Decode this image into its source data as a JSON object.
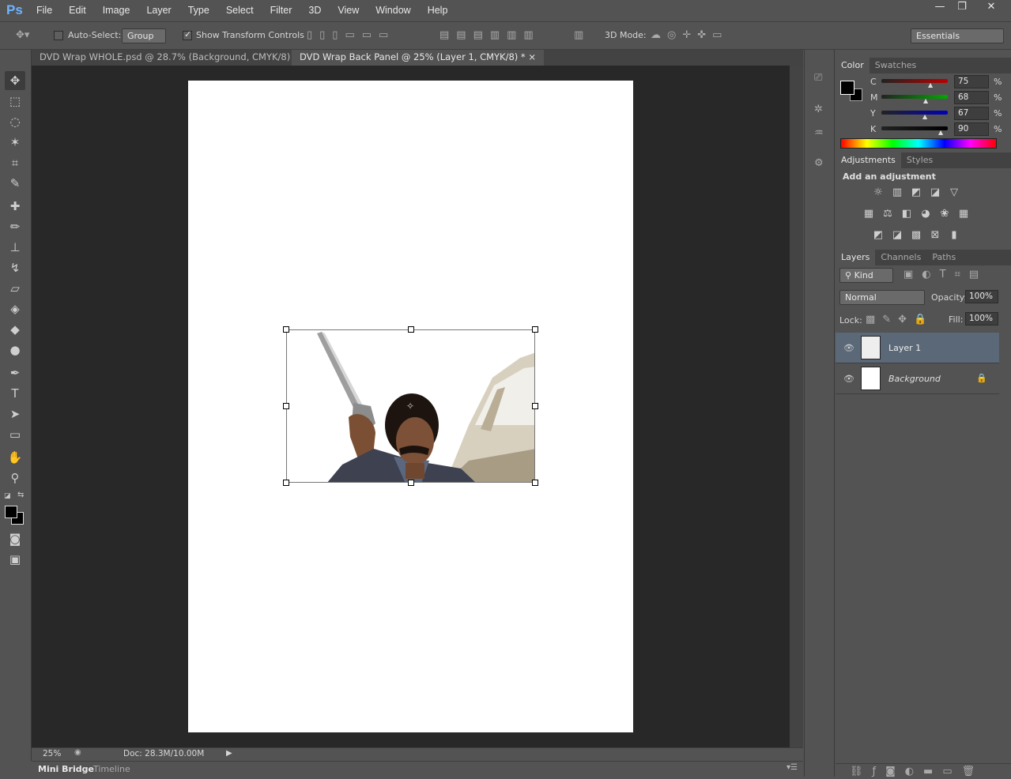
{
  "app": {
    "logo": "Ps"
  },
  "menu": [
    "File",
    "Edit",
    "Image",
    "Layer",
    "Type",
    "Select",
    "Filter",
    "3D",
    "View",
    "Window",
    "Help"
  ],
  "window_controls": {
    "minimize": "—",
    "restore": "❐",
    "close": "✕"
  },
  "options": {
    "auto_select_label": "Auto-Select:",
    "auto_select_value": "Group",
    "show_transform_label": "Show Transform Controls",
    "mode_3d_label": "3D Mode:",
    "workspace": "Essentials"
  },
  "tabs": [
    {
      "label": "DVD Wrap WHOLE.psd @ 28.7% (Background, CMYK/8) *",
      "close": "×"
    },
    {
      "label": "DVD Wrap Back Panel @ 25% (Layer 1, CMYK/8) *",
      "close": "×"
    }
  ],
  "status": {
    "zoom": "25%",
    "doc": "Doc: 28.3M/10.00M"
  },
  "bottom_tabs": [
    "Mini Bridge",
    "Timeline"
  ],
  "color_panel": {
    "tabs": [
      "Color",
      "Swatches"
    ],
    "channels": [
      {
        "name": "C",
        "value": "75",
        "unit": "%",
        "pos": 0.75,
        "color": "#b00"
      },
      {
        "name": "M",
        "value": "68",
        "unit": "%",
        "pos": 0.68,
        "color": "#0a0"
      },
      {
        "name": "Y",
        "value": "67",
        "unit": "%",
        "pos": 0.67,
        "color": "#00b"
      },
      {
        "name": "K",
        "value": "90",
        "unit": "%",
        "pos": 0.9,
        "color": "#000"
      }
    ]
  },
  "adjust_panel": {
    "tabs": [
      "Adjustments",
      "Styles"
    ],
    "heading": "Add an adjustment"
  },
  "layers_panel": {
    "tabs": [
      "Layers",
      "Channels",
      "Paths"
    ],
    "filter": "Kind",
    "blend": "Normal",
    "opacity_label": "Opacity:",
    "opacity": "100%",
    "lock_label": "Lock:",
    "fill_label": "Fill:",
    "fill": "100%",
    "layers": [
      {
        "name": "Layer 1",
        "selected": true
      },
      {
        "name": "Background",
        "selected": false
      }
    ]
  }
}
